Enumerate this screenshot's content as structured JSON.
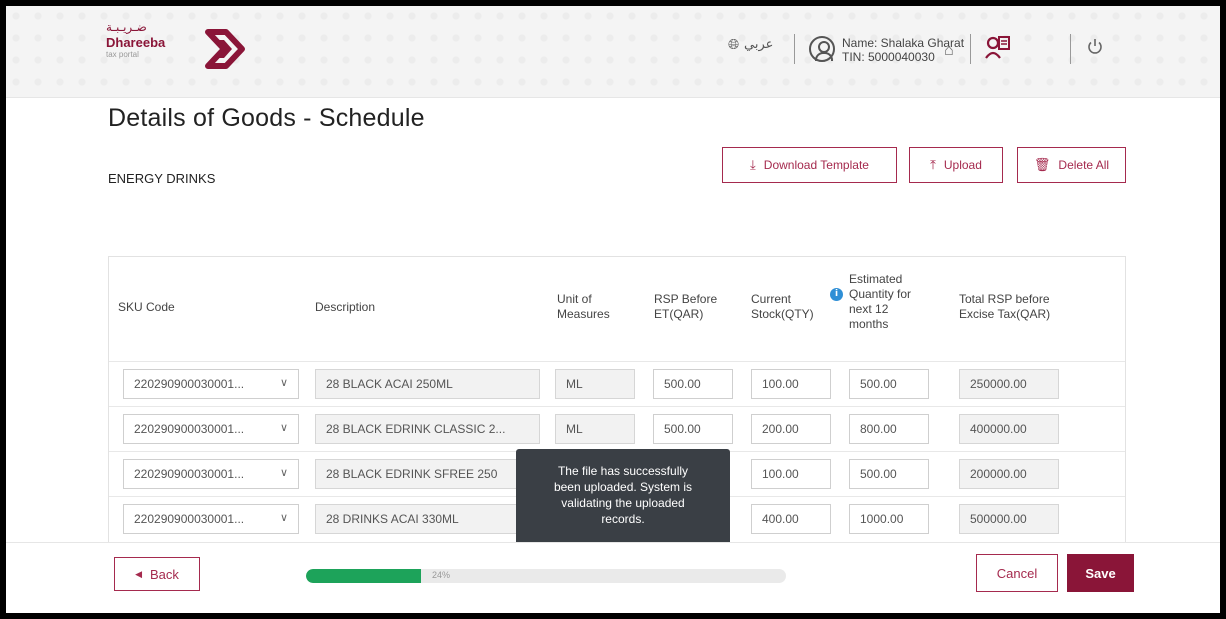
{
  "header": {
    "logo_ar": "ضـريـبـة",
    "logo_en": "Dhareeba",
    "logo_sub": "tax portal",
    "lang_label": "عربي",
    "user_name": "Name: Shalaka Gharat",
    "user_tin": "TIN: 5000040030"
  },
  "page": {
    "title": "Details of Goods - Schedule",
    "section": "ENERGY DRINKS"
  },
  "actions": {
    "download_template": "Download Template",
    "upload": "Upload",
    "delete_all": "Delete All"
  },
  "table": {
    "headers": {
      "sku": "SKU Code",
      "description": "Description",
      "unit_1": "Unit of",
      "unit_2": "Measures",
      "rsp_1": "RSP Before",
      "rsp_2": "ET(QAR)",
      "stock_1": "Current",
      "stock_2": "Stock(QTY)",
      "est_1": "Estimated",
      "est_2": "Quantity for",
      "est_3": "next 12",
      "est_4": "months",
      "total_1": "Total RSP before",
      "total_2": "Excise Tax(QAR)"
    },
    "rows": [
      {
        "sku": "220290900030001...",
        "description": "28 BLACK ACAI 250ML",
        "unit": "ML",
        "rsp": "500.00",
        "stock": "100.00",
        "estimated": "500.00",
        "total": "250000.00"
      },
      {
        "sku": "220290900030001...",
        "description": "28 BLACK EDRINK CLASSIC 2...",
        "unit": "ML",
        "rsp": "500.00",
        "stock": "200.00",
        "estimated": "800.00",
        "total": "400000.00"
      },
      {
        "sku": "220290900030001...",
        "description": "28 BLACK EDRINK SFREE 250",
        "unit": "",
        "rsp": "",
        "stock": "100.00",
        "estimated": "500.00",
        "total": "200000.00"
      },
      {
        "sku": "220290900030001...",
        "description": "28 DRINKS ACAI 330ML",
        "unit": "",
        "rsp": "",
        "stock": "400.00",
        "estimated": "1000.00",
        "total": "500000.00"
      }
    ]
  },
  "toast": {
    "line1": "The file has successfully",
    "line2": "been uploaded. System is",
    "line3": "validating the uploaded",
    "line4": "records."
  },
  "footer": {
    "back": "Back",
    "progress_label": "24%",
    "progress_value": 0.24,
    "cancel": "Cancel",
    "save": "Save"
  },
  "colors": {
    "brand": "#8a1538",
    "progress": "#1da35a",
    "info": "#2f8fd6"
  }
}
